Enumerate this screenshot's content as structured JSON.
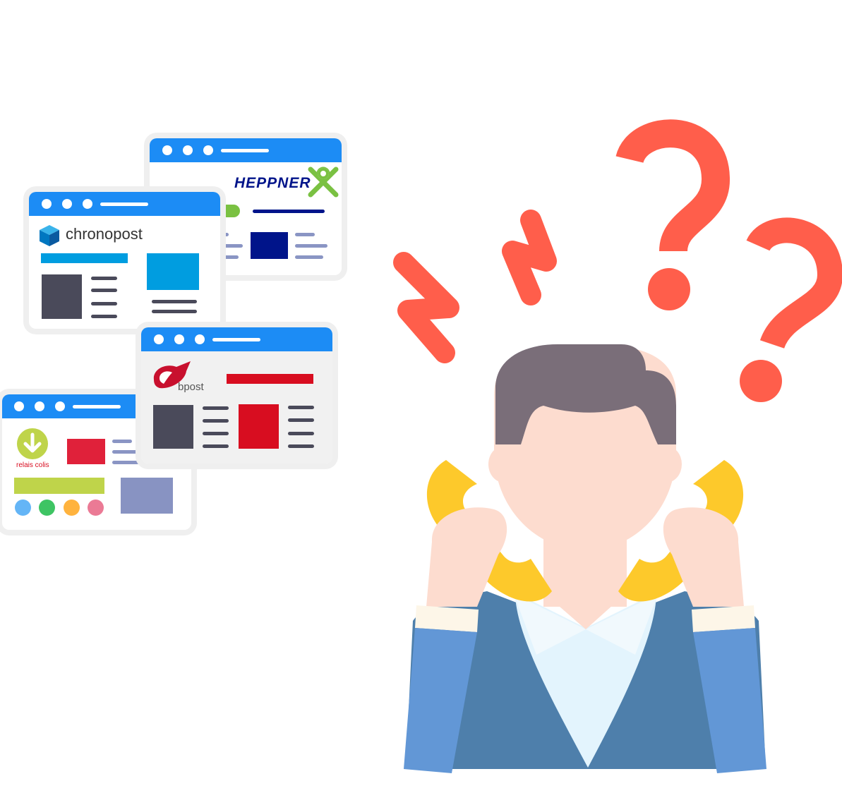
{
  "windows": {
    "heppner": {
      "brand": "HEPPNER"
    },
    "chronopost": {
      "brand": "chronopost"
    },
    "bpost": {
      "brand": "bpost"
    },
    "relais": {
      "brand": "relais colis"
    }
  },
  "colors": {
    "browser_bar": "#1c8cf5",
    "heppner_navy": "#00148a",
    "heppner_green": "#7ac142",
    "chronopost_blue": "#009de0",
    "bpost_red": "#d80d20",
    "relais_green": "#bfd44a",
    "dark_block": "#4a4a5a",
    "question_mark": "#ff5e4b",
    "hair": "#7a6e79",
    "skin": "#fddccf",
    "phone": "#fdc92b",
    "vest": "#4e7fab",
    "sleeve": "#6297d6"
  },
  "icons": [
    "cube-icon",
    "heppner-logo-icon",
    "bpost-horn-icon",
    "download-arrow-icon",
    "question-mark-icon",
    "zigzag-icon",
    "phone-receiver-icon"
  ]
}
